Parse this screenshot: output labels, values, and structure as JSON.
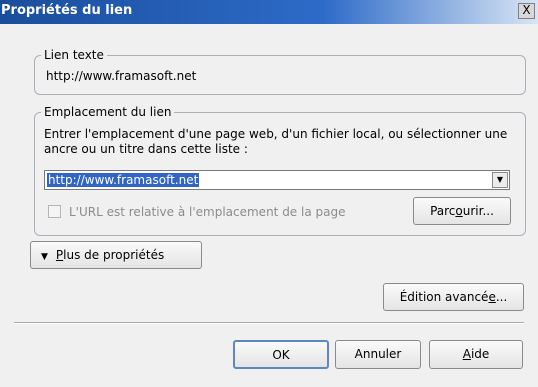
{
  "window": {
    "title": "Propriétés du lien",
    "close_label": "X"
  },
  "text_group": {
    "legend": "Lien texte",
    "value": "http://www.framasoft.net"
  },
  "location_group": {
    "legend": "Emplacement du lien",
    "instructions": "Entrer l'emplacement d'une page web, d'un fichier local, ou sélectionner une ancre ou un titre dans cette liste :",
    "url_value": "http://www.framasoft.net",
    "relative_checkbox_label": "L'URL est relative à l'emplacement de la page",
    "relative_checked": false,
    "browse_label_pre": "Parc",
    "browse_label_key": "o",
    "browse_label_post": "urir..."
  },
  "more_properties": {
    "label_key": "P",
    "label_rest": "lus de propriétés",
    "arrow_icon": "triangle-down-icon"
  },
  "advanced": {
    "label_pre": "Édition avancé",
    "label_key": "e",
    "label_post": "..."
  },
  "footer": {
    "ok_label": "OK",
    "cancel_label": "Annuler",
    "help_key": "A",
    "help_rest": "ide"
  }
}
